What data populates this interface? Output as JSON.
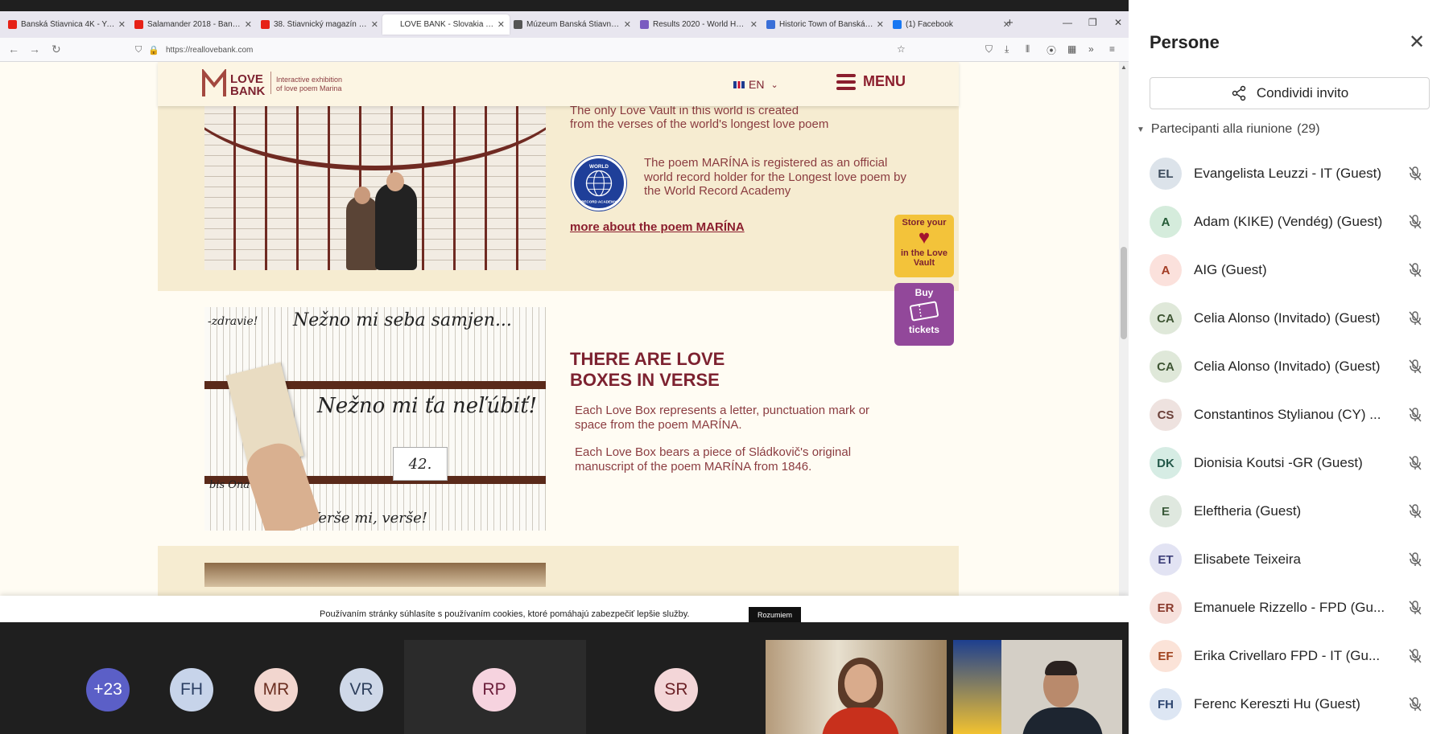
{
  "browser": {
    "tabs": [
      {
        "label": "Banská Štiavnica 4K - YouTube",
        "fav": "#e62117"
      },
      {
        "label": "Salamander 2018 - Banská Štiavnica",
        "fav": "#e62117"
      },
      {
        "label": "38. Štiavnický magazín 2020",
        "fav": "#e62117"
      },
      {
        "label": "LOVE BANK - Slovakia | The Official",
        "fav": "#ffffff"
      },
      {
        "label": "Múzeum Banská Štiavnica",
        "fav": "#555555"
      },
      {
        "label": "Results 2020 - World Heritage",
        "fav": "#7a5bc0"
      },
      {
        "label": "Historic Town of Banská Štiavnica",
        "fav": "#3a6fd8"
      },
      {
        "label": "(1) Facebook",
        "fav": "#1877f2"
      }
    ],
    "url": "https://reallovebank.com",
    "icons": {
      "back": "back-arrow-icon",
      "forward": "forward-arrow-icon",
      "reload": "reload-icon",
      "shield": "shield-icon",
      "lock": "lock-icon",
      "star": "bookmark-star-icon"
    }
  },
  "site": {
    "logo_text_line1": "LOVE",
    "logo_text_line2": "BANK",
    "logo_tagline_line1": "Interactive exhibition",
    "logo_tagline_line2": "of love poem Marina",
    "lang": "EN",
    "menu_label": "MENU",
    "vault_text_line1": "The only Love Vault in this world is created",
    "vault_text_line2": "from the verses of the world's longest love poem",
    "seal_top": "WORLD",
    "seal_bottom": "RECORD ACADEMY",
    "record_text": "The poem MARÍNA is registered as an official world record holder for the Longest love poem by the World Record Academy",
    "more_link": "more about the poem MARÍNA",
    "love_title_line1": "THERE ARE LOVE",
    "love_title_line2": "BOXES IN VERSE",
    "love_p1": "Each Love Box represents a letter, punctuation mark or space from the poem MARÍNA.",
    "love_p2": "Each Love Box bears a piece of Sládkovič's original manuscript of the poem MARÍNA from 1846.",
    "photo_script_1": "Nežno mi seba samjen...",
    "photo_script_2": "Nežno mi ťa neľúbiť!",
    "photo_script_3": "Verše mi, verše!",
    "photo_script_4": "-zdravie!",
    "photo_script_5": "bis Ona",
    "photo_tag": "42.",
    "store_vault_line1": "Store your",
    "store_vault_line2": "in the Love",
    "store_vault_line3": "Vault",
    "buy_line1": "Buy",
    "buy_line2": "tickets",
    "cookie_text": "Používaním stránky súhlasíte s používaním cookies, ktoré pomáhajú zabezpečiť lepšie služby.",
    "cookie_button": "Rozumiem"
  },
  "meeting": {
    "tiles": [
      {
        "initials": "+23",
        "color": "#5b5fc7",
        "text_color": "#ffffff"
      },
      {
        "initials": "FH",
        "color": "#c7d4ea",
        "text_color": "#2b3f63"
      },
      {
        "initials": "MR",
        "color": "#f2d6cf",
        "text_color": "#6b2e20"
      },
      {
        "initials": "VR",
        "color": "#cfd8e8",
        "text_color": "#2e3f5c"
      },
      {
        "initials": "RP",
        "color": "#f6d3df",
        "text_color": "#6b1d3a"
      },
      {
        "initials": "SR",
        "color": "#f3d6d8",
        "text_color": "#6b2227"
      }
    ]
  },
  "panel": {
    "title": "Persone",
    "share_label": "Condividi invito",
    "participants_label": "Partecipanti alla riunione",
    "participants_count": "(29)",
    "participants": [
      {
        "initials": "EL",
        "name": "Evangelista Leuzzi - IT (Guest)",
        "bg": "#dce3ea",
        "fg": "#3c4b5c"
      },
      {
        "initials": "A",
        "name": "Adam (KIKE) (Vendég) (Guest)",
        "bg": "#d5ecdc",
        "fg": "#245b36"
      },
      {
        "initials": "A",
        "name": "AIG (Guest)",
        "bg": "#fbe1dc",
        "fg": "#a33c25"
      },
      {
        "initials": "CA",
        "name": "Celia Alonso (Invitado) (Guest)",
        "bg": "#dfe8d9",
        "fg": "#3e5533"
      },
      {
        "initials": "CA",
        "name": "Celia Alonso (Invitado) (Guest)",
        "bg": "#dfe8d9",
        "fg": "#3e5533"
      },
      {
        "initials": "CS",
        "name": "Constantinos Stylianou (CY) ...",
        "bg": "#eee2df",
        "fg": "#6b4039"
      },
      {
        "initials": "DK",
        "name": "Dionisia Koutsi -GR (Guest)",
        "bg": "#d6ece4",
        "fg": "#24594a"
      },
      {
        "initials": "E",
        "name": "Eleftheria (Guest)",
        "bg": "#dfe8df",
        "fg": "#3a5a3a"
      },
      {
        "initials": "ET",
        "name": "Elisabete Teixeira",
        "bg": "#e2e3f3",
        "fg": "#3d3f78"
      },
      {
        "initials": "ER",
        "name": "Emanuele Rizzello - FPD (Gu...",
        "bg": "#f7e1dc",
        "fg": "#8a3a2c"
      },
      {
        "initials": "EF",
        "name": "Erika Crivellaro FPD - IT (Gu...",
        "bg": "#fbe3d8",
        "fg": "#a0431e"
      },
      {
        "initials": "FH",
        "name": "Ferenc Kereszti Hu (Guest)",
        "bg": "#dde6f3",
        "fg": "#2e4670"
      }
    ]
  }
}
